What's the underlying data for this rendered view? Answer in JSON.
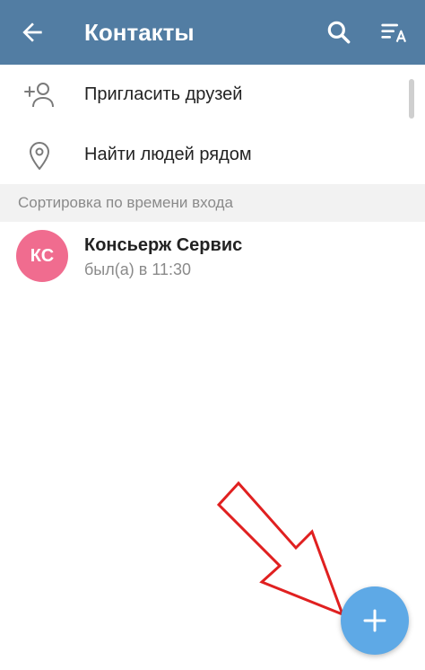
{
  "header": {
    "title": "Контакты",
    "back_icon": "arrow-left-icon",
    "search_icon": "search-icon",
    "sort_icon": "sort-by-name-icon",
    "bg_color": "#527DA3"
  },
  "actions": [
    {
      "label": "Пригласить друзей",
      "icon": "add-person-icon"
    },
    {
      "label": "Найти людей рядом",
      "icon": "location-pin-icon"
    }
  ],
  "section": {
    "label": "Сортировка по времени входа"
  },
  "contacts": [
    {
      "initials": "КС",
      "name": "Консьерж Сервис",
      "status": "был(а) в 11:30",
      "avatar_color": "#F06C8F"
    }
  ],
  "fab": {
    "icon": "plus-icon",
    "color": "#5EA9E6"
  },
  "annotation": {
    "icon": "red-arrow-icon",
    "color": "#E02020"
  }
}
